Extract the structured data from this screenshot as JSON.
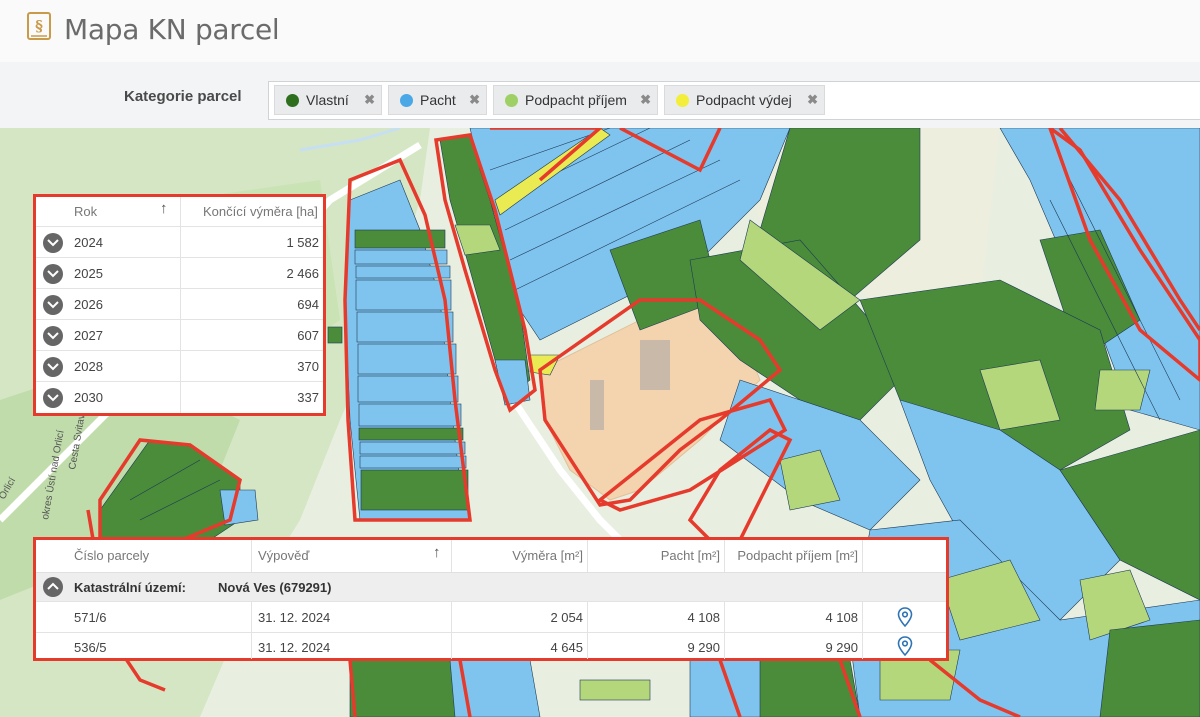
{
  "page": {
    "title": "Mapa KN parcel"
  },
  "filter": {
    "label": "Kategorie parcel",
    "chips": [
      {
        "label": "Vlastní",
        "color": "#2e6f1e"
      },
      {
        "label": "Pacht",
        "color": "#4aa8e6"
      },
      {
        "label": "Podpacht příjem",
        "color": "#9fd065"
      },
      {
        "label": "Podpacht výdej",
        "color": "#f2ee3a"
      }
    ],
    "remove_icon": "close-icon"
  },
  "map": {
    "colors": {
      "own": "#4a8c3a",
      "lease": "#7fc4ee",
      "sublease_in": "#b3d77a",
      "sublease_out": "#eaea52",
      "highlight_border": "#e53a2c",
      "building_area": "#f5d6b0"
    },
    "labels": {
      "road_name": "okres Ústí nad Orlicí",
      "road_name_2": "Cesta Svitavy",
      "corner_label": "Orlicí"
    }
  },
  "year_table": {
    "headers": {
      "year": "Rok",
      "area": "Končící výměra [ha]"
    },
    "sort_icon": "arrow-up-icon",
    "rows": [
      {
        "year": "2024",
        "area": "1 582"
      },
      {
        "year": "2025",
        "area": "2 466"
      },
      {
        "year": "2026",
        "area": "694"
      },
      {
        "year": "2027",
        "area": "607"
      },
      {
        "year": "2028",
        "area": "370"
      },
      {
        "year": "2030",
        "area": "337"
      }
    ]
  },
  "parcel_table": {
    "headers": {
      "parcel": "Číslo parcely",
      "notice": "Výpověď",
      "area": "Výměra [m²]",
      "lease": "Pacht [m²]",
      "sublease": "Podpacht příjem [m²]"
    },
    "group": {
      "label": "Katastrální území:",
      "value": "Nová Ves (679291)"
    },
    "rows": [
      {
        "parcel": "571/6",
        "notice": "31. 12. 2024",
        "area": "2 054",
        "lease": "4 108",
        "sublease": "4 108"
      },
      {
        "parcel": "536/5",
        "notice": "31. 12. 2024",
        "area": "4 645",
        "lease": "9 290",
        "sublease": "9 290"
      }
    ]
  }
}
